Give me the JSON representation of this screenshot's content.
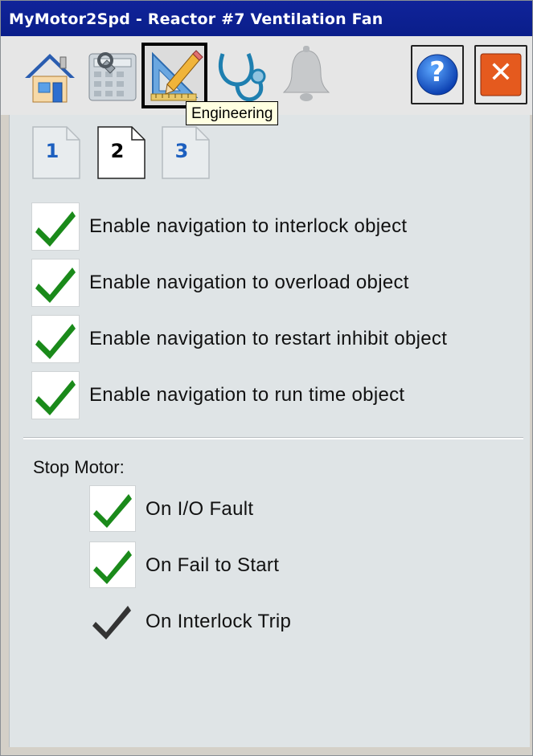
{
  "window": {
    "title": "MyMotor2Spd - Reactor #7 Ventilation Fan"
  },
  "toolbar": {
    "buttons": [
      {
        "name": "home",
        "icon": "home-icon"
      },
      {
        "name": "operator",
        "icon": "calculator-wrench-icon"
      },
      {
        "name": "engineering",
        "icon": "engineering-ruler-pencil-icon",
        "selected": true
      },
      {
        "name": "diagnostics",
        "icon": "stethoscope-icon"
      },
      {
        "name": "alarms",
        "icon": "bell-icon"
      }
    ],
    "help_glyph": "?",
    "close_glyph": "✕",
    "tooltip": "Engineering"
  },
  "pages": {
    "tab1": "1",
    "tab2": "2",
    "tab3": "3",
    "active": 2
  },
  "options": [
    {
      "label": "Enable navigation to interlock object",
      "checked": true
    },
    {
      "label": "Enable navigation to overload object",
      "checked": true
    },
    {
      "label": "Enable navigation to restart inhibit object",
      "checked": true
    },
    {
      "label": "Enable navigation to run time object",
      "checked": true
    }
  ],
  "stop_motor": {
    "label": "Stop Motor:",
    "items": [
      {
        "label": "On I/O Fault",
        "checked": true,
        "enabled": true
      },
      {
        "label": "On Fail to Start",
        "checked": true,
        "enabled": true
      },
      {
        "label": "On Interlock Trip",
        "checked": true,
        "enabled": false
      }
    ]
  },
  "colors": {
    "check_green": "#1a8a1a",
    "check_dark": "#333333",
    "title_bar": "#10239a",
    "tab_blue": "#1c5fbf",
    "panel": "#dfe4e6"
  }
}
